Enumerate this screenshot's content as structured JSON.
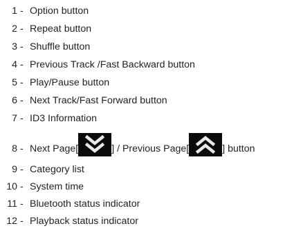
{
  "items": [
    {
      "number": "1",
      "sep": "-",
      "label": "Option button"
    },
    {
      "number": "2",
      "sep": "-",
      "label": "Repeat button"
    },
    {
      "number": "3",
      "sep": "-",
      "label": "Shuffle button"
    },
    {
      "number": "4",
      "sep": "-",
      "label": "Previous Track /Fast Backward button"
    },
    {
      "number": "5",
      "sep": "-",
      "label": "Play/Pause button"
    },
    {
      "number": "6",
      "sep": "-",
      "label": "Next Track/Fast Forward button"
    },
    {
      "number": "7",
      "sep": "-",
      "label": "ID3 Information"
    },
    {
      "number": "8",
      "sep": "-",
      "label_part1": "Next Page[",
      "label_part2": "] / Previous Page[",
      "label_part3": "] button"
    },
    {
      "number": "9",
      "sep": "-",
      "label": "Category list"
    },
    {
      "number": "10",
      "sep": "-",
      "label": "System time"
    },
    {
      "number": "11",
      "sep": "-",
      "label": "Bluetooth status indicator"
    },
    {
      "number": "12",
      "sep": "-",
      "label": "Playback status indicator"
    }
  ],
  "icons": {
    "next_page": "double-chevron-down-icon",
    "previous_page": "double-chevron-up-icon",
    "icon_background": "#0b0b0b",
    "icon_color": "#e8e8e8"
  }
}
